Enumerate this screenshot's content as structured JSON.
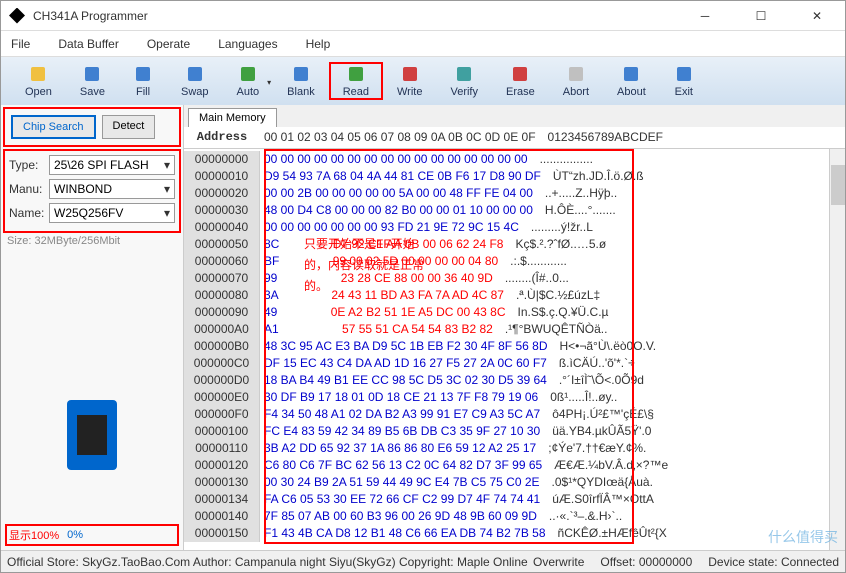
{
  "window": {
    "title": "CH341A Programmer"
  },
  "menu": [
    "File",
    "Data Buffer",
    "Operate",
    "Languages",
    "Help"
  ],
  "toolbar": [
    {
      "label": "Open",
      "icon": "folder",
      "color": "#f0c040"
    },
    {
      "label": "Save",
      "icon": "floppy",
      "color": "#4080d0"
    },
    {
      "label": "Fill",
      "icon": "fill",
      "color": "#4080d0"
    },
    {
      "label": "Swap",
      "icon": "swap",
      "color": "#4080d0"
    },
    {
      "label": "Auto",
      "icon": "auto",
      "color": "#40a040",
      "dd": true
    },
    {
      "label": "Blank",
      "icon": "blank",
      "color": "#4080d0"
    },
    {
      "label": "Read",
      "icon": "read",
      "color": "#40a040",
      "hl": true
    },
    {
      "label": "Write",
      "icon": "write",
      "color": "#d04040"
    },
    {
      "label": "Verify",
      "icon": "verify",
      "color": "#40a0a0"
    },
    {
      "label": "Erase",
      "icon": "erase",
      "color": "#d04040"
    },
    {
      "label": "Abort",
      "icon": "abort",
      "color": "#c0c0c0"
    },
    {
      "label": "About",
      "icon": "about",
      "color": "#4080d0"
    },
    {
      "label": "Exit",
      "icon": "exit",
      "color": "#4080d0"
    }
  ],
  "sidebar": {
    "chip_search": "Chip Search",
    "detect": "Detect",
    "type_lbl": "Type:",
    "type_val": "25\\26 SPI FLASH",
    "manu_lbl": "Manu:",
    "manu_val": "WINBOND",
    "name_lbl": "Name:",
    "name_val": "W25Q256FV",
    "size": "Size:  32MByte/256Mbit",
    "progress_lbl": "显示100%",
    "progress_val": "0%"
  },
  "tab": "Main Memory",
  "hex_header_addr": "Address",
  "hex_header_bytes": "00 01 02 03 04 05 06 07 08 09 0A 0B 0C 0D 0E 0F",
  "hex_header_ascii": "0123456789ABCDEF",
  "rows": [
    {
      "addr": "00000000",
      "b": "00 00 00 00 00 00 00 00 00 00 00 00 00 00 00 00",
      "a": "................"
    },
    {
      "addr": "00000010",
      "b": "D9 54 93 7A 68 04 4A 44 81 CE 0B F6 17 D8 90 DF",
      "a": "ÙT“zh.JD.Î.ö.Ø.ß"
    },
    {
      "addr": "00000020",
      "b": "00 00 2B 00 00 00 00 00 5A 00 00 48 FF FE 04 00",
      "a": "..+.....Z..Hÿþ.."
    },
    {
      "addr": "00000030",
      "b": "48 00 D4 C8 00 00 00 82 B0 00 00 01 10 00 00 00",
      "a": "H.ÔÈ....°......."
    },
    {
      "addr": "00000040",
      "b": "00 00 00 00 00 00 00 93 FD 21 9E 72 9C 15 4C",
      "a": ".........ý!žr..L"
    },
    {
      "addr": "00000050",
      "b": "8C",
      "rb": "D7 92 C1 AA 0B 00 06 62 24 F8",
      "a": "Kç$.².?ˆfØ..…5.ø"
    },
    {
      "addr": "00000060",
      "b": "BF",
      "rb": "99 00 02 5D 00 00 00 00 04 80",
      "a": ".:.$............"
    },
    {
      "addr": "00000070",
      "b": "99",
      "rb": "23 28 CE 88 00 00 36 40 9D",
      "a": "........(Î#..0..."
    },
    {
      "addr": "00000080",
      "b": "3A",
      "rb": "24 43 11 BD A3 FA 7A AD 4C 87",
      "a": ".ª.Ù|$C.½£úz­L‡"
    },
    {
      "addr": "00000090",
      "b": "49",
      "rb": "0E A2 B2 51 1E A5 DC 00 43 8C",
      "a": "In.S$.ç.Q.¥Ü.C.µ"
    },
    {
      "addr": "000000A0",
      "b": "A1",
      "rb": "57 55 51 CA 54 54 83 B2 82",
      "a": ".¹¶°BWUQÊTÑÒä.."
    },
    {
      "addr": "000000B0",
      "b": "48 3C 95 AC E3 BA D9 5C 1B EB F2 30 4F 8F 56 8D",
      "a": "H<•¬ã°Ù\\.ëò0O.V."
    },
    {
      "addr": "000000C0",
      "b": "DF 15 EC 43 C4 DA AD 1D 16 27 F5 27 2A 0C 60 F7",
      "a": "ß.ìCÄÚ­..'õ'*.`÷"
    },
    {
      "addr": "000000D0",
      "b": "18 BA B4 49 B1 EE CC 98 5C D5 3C 02 30 D5 39 64",
      "a": ".°´I±îÌ˜\\Õ<.0Õ9d"
    },
    {
      "addr": "000000E0",
      "b": "30 DF B9 17 18 01 0D 18 CE 21 13 7F F8 79 19 06",
      "a": "0ß¹.....Î!..øy.."
    },
    {
      "addr": "000000F0",
      "b": "F4 34 50 48 A1 02 DA B2 A3 99 91 E7 C9 A3 5C A7",
      "a": "ô4PH¡.Ú²£™'çÉ£\\§"
    },
    {
      "addr": "00000100",
      "b": "FC E4 83 59 42 34 89 B5 6B DB C3 35 9F 27 10 30",
      "a": "üä.YB4.µkÛÃ5Ÿ'.0"
    },
    {
      "addr": "00000110",
      "b": "3B A2 DD 65 92 37 1A 86 86 80 E6 59 12 A2 25 17",
      "a": ";¢Ýe'7.††€æY.¢%."
    },
    {
      "addr": "00000120",
      "b": "C6 80 C6 7F BC 62 56 13 C2 0C 64 82 D7 3F 99 65",
      "a": "Æ€Æ.¼bV.Â.d‚×?™e"
    },
    {
      "addr": "00000130",
      "b": "00 30 24 B9 2A 51 59 44 49 9C E4 7B C5 75 C0 2E",
      "a": ".0$¹*QYDIœä{Åuà."
    },
    {
      "addr": "00000134",
      "b": "FA C6 05 53 30 EE 72 66 CF C2 99 D7 4F 74 74 41",
      "a": "úÆ.S0îrfÏÂ™×OttA"
    },
    {
      "addr": "00000140",
      "b": "7F 85 07 AB 00 60 B3 96 00 26 9D 48 9B 60 09 9D",
      "a": "..·«.`³–.&.H›`.."
    },
    {
      "addr": "00000150",
      "b": "F1 43 4B CA D8 12 B1 48 C6 66 EA DB 74 B2 7B 58",
      "a": "ñCKÊØ.±HÆfêÛt²{X"
    }
  ],
  "annotations": [
    "只要开始不是FF开始",
    "的，内容读取就是正常",
    "的。"
  ],
  "status": {
    "left": "Official Store: SkyGz.TaoBao.Com Author: Campanula night Siyu(SkyGz) Copyright: Maple Online",
    "mid": "Overwrite",
    "off": "Offset: 00000000",
    "dev": "Device state: Connected"
  },
  "watermark": "什么值得买"
}
